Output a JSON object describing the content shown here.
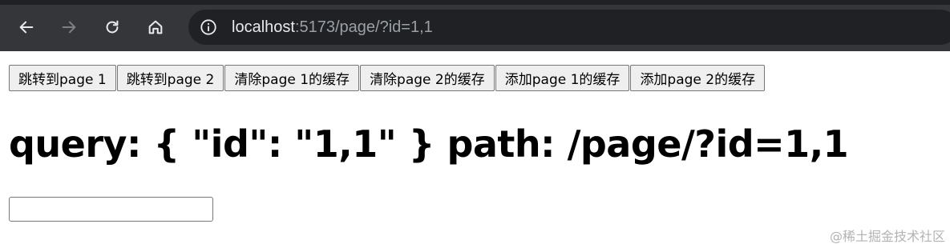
{
  "browser": {
    "url_host": "localhost",
    "url_rest": ":5173/page/?id=1,1"
  },
  "buttons": [
    {
      "label": "跳转到page 1"
    },
    {
      "label": "跳转到page 2"
    },
    {
      "label": "清除page 1的缓存"
    },
    {
      "label": "清除page 2的缓存"
    },
    {
      "label": "添加page 1的缓存"
    },
    {
      "label": "添加page 2的缓存"
    }
  ],
  "main": {
    "heading": "query: { \"id\": \"1,1\" } path: /page/?id=1,1",
    "input_value": ""
  },
  "watermark": "@稀土掘金技术社区",
  "icons": [
    "back-arrow-icon",
    "forward-arrow-icon",
    "reload-icon",
    "home-icon",
    "info-icon"
  ]
}
